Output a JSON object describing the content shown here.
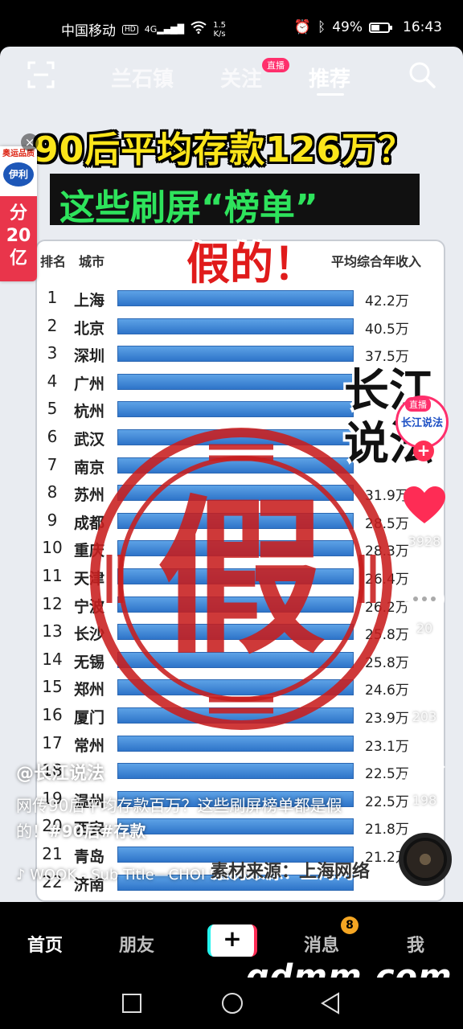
{
  "status": {
    "carrier": "中国移动",
    "hd": "HD",
    "signal": "4G",
    "speed_value": "1.5",
    "speed_unit": "K/s",
    "battery_text": "49%",
    "battery_level": 0.49,
    "time": "16:43"
  },
  "topnav": {
    "tabs": [
      "兰石镇",
      "关注",
      "推荐"
    ],
    "active_tab": "推荐",
    "live_badge": "直播"
  },
  "promo": {
    "top": "奥运品质",
    "brand": "伊利",
    "big_line1": "分",
    "big_line2": "20",
    "big_line3": "亿",
    "close": "×"
  },
  "video": {
    "headline1": "90后平均存款126万？",
    "headline2": "这些刷屏“榜单”",
    "headline3": "假的！",
    "side_title": "长江说法",
    "source": "素材来源：上海网络",
    "stamp_char": "假",
    "table": {
      "col_rank": "排名",
      "col_city": "城市",
      "col_income": "平均综合年收入",
      "rows": [
        {
          "rank": "1",
          "city": "上海",
          "value": "42.2万"
        },
        {
          "rank": "2",
          "city": "北京",
          "value": "40.5万"
        },
        {
          "rank": "3",
          "city": "深圳",
          "value": "37.5万"
        },
        {
          "rank": "4",
          "city": "广州",
          "value": ""
        },
        {
          "rank": "5",
          "city": "杭州",
          "value": ""
        },
        {
          "rank": "6",
          "city": "武汉",
          "value": ""
        },
        {
          "rank": "7",
          "city": "南京",
          "value": ""
        },
        {
          "rank": "8",
          "city": "苏州",
          "value": "31.9万"
        },
        {
          "rank": "9",
          "city": "成都",
          "value": "28.5万"
        },
        {
          "rank": "10",
          "city": "重庆",
          "value": "28.3万"
        },
        {
          "rank": "11",
          "city": "天津",
          "value": "26.4万"
        },
        {
          "rank": "12",
          "city": "宁波",
          "value": "26.2万"
        },
        {
          "rank": "13",
          "city": "长沙",
          "value": "25.8万"
        },
        {
          "rank": "14",
          "city": "无锡",
          "value": "25.8万"
        },
        {
          "rank": "15",
          "city": "郑州",
          "value": "24.6万"
        },
        {
          "rank": "16",
          "city": "厦门",
          "value": "23.9万"
        },
        {
          "rank": "17",
          "city": "常州",
          "value": "23.1万"
        },
        {
          "rank": "18",
          "city": "",
          "value": "22.5万"
        },
        {
          "rank": "19",
          "city": "温州",
          "value": "22.5万"
        },
        {
          "rank": "20",
          "city": "西安",
          "value": "21.8万"
        },
        {
          "rank": "21",
          "city": "青岛",
          "value": "21.2万"
        },
        {
          "rank": "22",
          "city": "济南",
          "value": ""
        }
      ]
    }
  },
  "rail": {
    "avatar_name": "长江说法",
    "avatar_live": "直播",
    "follow": "+",
    "likes": "3928",
    "comments": "20",
    "favorites": "203",
    "shares": "198"
  },
  "caption": {
    "author": "@长江说法",
    "desc": "网传90后平均存款百万？这些刷屏榜单都是假的！",
    "tags": "#90后#存款",
    "music": "WOOK - Sub Title—CHOI SEONG"
  },
  "tabbar": {
    "home": "首页",
    "friends": "朋友",
    "plus": "+",
    "messages": "消息",
    "messages_badge": "8",
    "me": "我"
  },
  "watermark": "gdmm.com",
  "colors": {
    "accent": "#fe2c55",
    "headline_yellow": "#fbe51a",
    "headline_green": "#2ee35c",
    "stamp_red": "#c81e1e",
    "bar_blue": "#3b82d6"
  }
}
